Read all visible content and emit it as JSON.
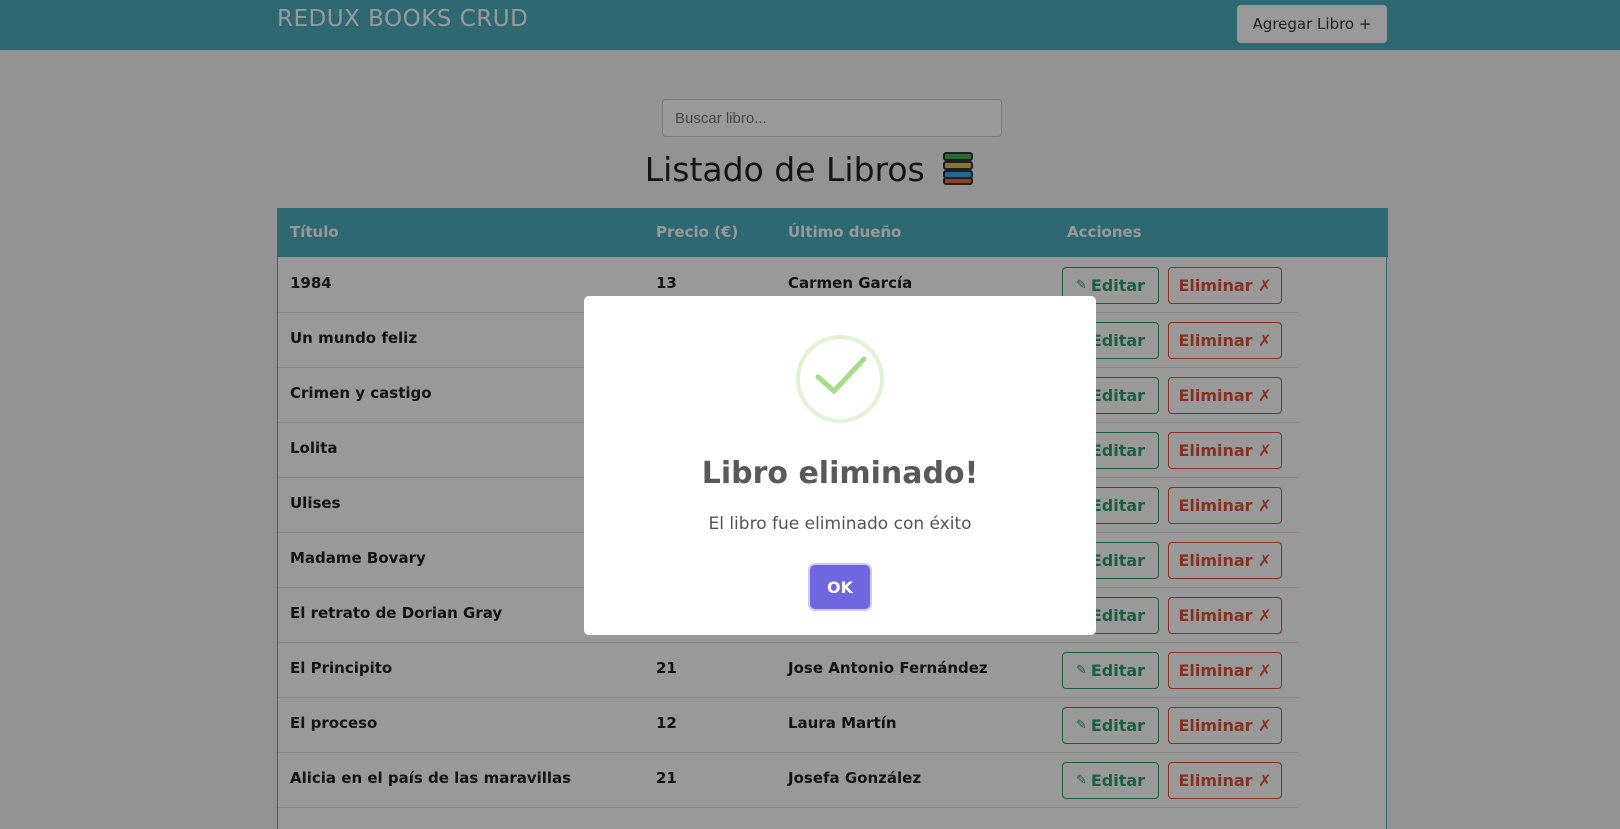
{
  "navbar": {
    "brand": "REDUX BOOKS CRUD",
    "add_button": "Agregar Libro +"
  },
  "search": {
    "placeholder": "Buscar libro..."
  },
  "page": {
    "title": "Listado de Libros",
    "title_icon": "books-emoji-icon"
  },
  "table": {
    "headers": [
      "Título",
      "Precio (€)",
      "Último dueño",
      "Acciones"
    ],
    "edit_label": "Editar",
    "delete_label": "Eliminar ✗",
    "rows": [
      {
        "title": "1984",
        "price": "13",
        "owner": "Carmen García"
      },
      {
        "title": "Un mundo feliz",
        "price": "",
        "owner": ""
      },
      {
        "title": "Crimen y castigo",
        "price": "",
        "owner": ""
      },
      {
        "title": "Lolita",
        "price": "",
        "owner": ""
      },
      {
        "title": "Ulises",
        "price": "",
        "owner": ""
      },
      {
        "title": "Madame Bovary",
        "price": "",
        "owner": ""
      },
      {
        "title": "El retrato de Dorian Gray",
        "price": "",
        "owner": ""
      },
      {
        "title": "El Principito",
        "price": "21",
        "owner": "Jose Antonio Fernández"
      },
      {
        "title": "El proceso",
        "price": "12",
        "owner": "Laura Martín"
      },
      {
        "title": "Alicia en el país de las maravillas",
        "price": "21",
        "owner": "Josefa González"
      }
    ]
  },
  "modal": {
    "icon": "success-check-icon",
    "title": "Libro eliminado!",
    "text": "El libro fue eliminado con éxito",
    "ok_label": "OK"
  },
  "colors": {
    "primary": "#4eaebf",
    "edit": "#2e9e6f",
    "delete": "#e0533a",
    "confirm": "#7066e0",
    "success": "#a5dc86"
  }
}
